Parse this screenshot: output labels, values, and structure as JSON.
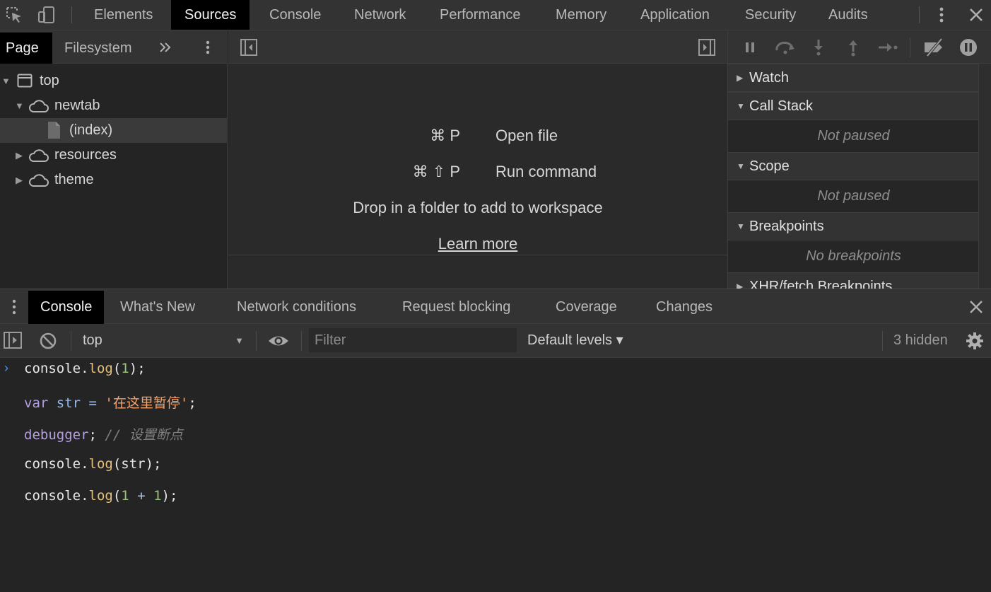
{
  "main_tabs": [
    "Elements",
    "Sources",
    "Console",
    "Network",
    "Performance",
    "Memory",
    "Application",
    "Security",
    "Audits"
  ],
  "active_main_tab": "Sources",
  "navigator": {
    "tabs": [
      "Page",
      "Filesystem"
    ],
    "active_tab": "Page",
    "tree": [
      {
        "label": "top",
        "type": "frame",
        "expanded": true
      },
      {
        "label": "newtab",
        "type": "origin",
        "expanded": true
      },
      {
        "label": "(index)",
        "type": "file",
        "selected": true
      },
      {
        "label": "resources",
        "type": "origin",
        "expanded": false
      },
      {
        "label": "theme",
        "type": "origin",
        "expanded": false
      }
    ]
  },
  "editor": {
    "shortcuts": [
      {
        "keys": "⌘ P",
        "label": "Open file"
      },
      {
        "keys": "⌘ ⇧ P",
        "label": "Run command"
      }
    ],
    "drop_text": "Drop in a folder to add to workspace",
    "learn_more": "Learn more"
  },
  "debugger": {
    "panes": [
      {
        "title": "Watch",
        "expanded": false,
        "body": ""
      },
      {
        "title": "Call Stack",
        "expanded": true,
        "body": "Not paused"
      },
      {
        "title": "Scope",
        "expanded": true,
        "body": "Not paused"
      },
      {
        "title": "Breakpoints",
        "expanded": true,
        "body": "No breakpoints"
      },
      {
        "title": "XHR/fetch Breakpoints",
        "expanded": false,
        "body": ""
      }
    ]
  },
  "drawer": {
    "tabs": [
      "Console",
      "What's New",
      "Network conditions",
      "Request blocking",
      "Coverage",
      "Changes"
    ],
    "active_tab": "Console"
  },
  "console_toolbar": {
    "context": "top",
    "filter_placeholder": "Filter",
    "levels": "Default levels ▾",
    "hidden": "3 hidden"
  },
  "console_code": [
    [
      {
        "t": "console.",
        "c": "plain"
      },
      {
        "t": "log",
        "c": "fn"
      },
      {
        "t": "(",
        "c": "plain"
      },
      {
        "t": "1",
        "c": "num"
      },
      {
        "t": ");",
        "c": "plain"
      }
    ],
    [
      {
        "t": "var ",
        "c": "kw"
      },
      {
        "t": "str",
        "c": "var"
      },
      {
        "t": " = ",
        "c": "op"
      },
      {
        "t": "'在这里暂停'",
        "c": "str"
      },
      {
        "t": ";",
        "c": "plain"
      }
    ],
    [
      {
        "t": "debugger",
        "c": "kw"
      },
      {
        "t": "; ",
        "c": "plain"
      },
      {
        "t": "// 设置断点",
        "c": "cmt"
      }
    ],
    [
      {
        "t": "console.",
        "c": "plain"
      },
      {
        "t": "log",
        "c": "fn"
      },
      {
        "t": "(str);",
        "c": "plain"
      }
    ],
    [
      {
        "t": "console.",
        "c": "plain"
      },
      {
        "t": "log",
        "c": "fn"
      },
      {
        "t": "(",
        "c": "plain"
      },
      {
        "t": "1",
        "c": "num"
      },
      {
        "t": " + ",
        "c": "op"
      },
      {
        "t": "1",
        "c": "num"
      },
      {
        "t": ");",
        "c": "plain"
      }
    ]
  ]
}
